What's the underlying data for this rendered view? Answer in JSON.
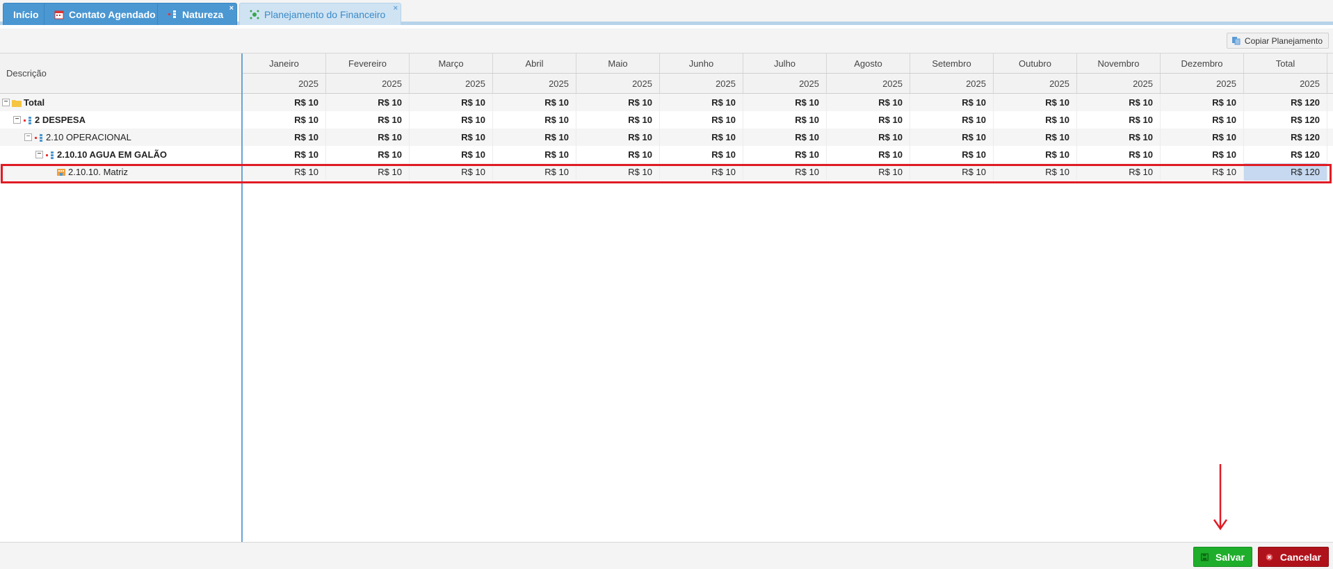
{
  "tabs": [
    {
      "label": "Início"
    },
    {
      "label": "Contato Agendado"
    },
    {
      "label": "Natureza",
      "close": "×"
    },
    {
      "label": "Planejamento do Financeiro",
      "close": "×"
    }
  ],
  "toolbar": {
    "copy_label": "Copiar Planejamento"
  },
  "grid": {
    "desc_header": "Descrição",
    "months": [
      "Janeiro",
      "Fevereiro",
      "Março",
      "Abril",
      "Maio",
      "Junho",
      "Julho",
      "Agosto",
      "Setembro",
      "Outubro",
      "Novembro",
      "Dezembro",
      "Total"
    ],
    "years": [
      "2025",
      "2025",
      "2025",
      "2025",
      "2025",
      "2025",
      "2025",
      "2025",
      "2025",
      "2025",
      "2025",
      "2025",
      "2025"
    ],
    "rows": [
      {
        "label": "Total",
        "toggle": "−",
        "values": [
          "R$ 10",
          "R$ 10",
          "R$ 10",
          "R$ 10",
          "R$ 10",
          "R$ 10",
          "R$ 10",
          "R$ 10",
          "R$ 10",
          "R$ 10",
          "R$ 10",
          "R$ 10",
          "R$ 120"
        ]
      },
      {
        "label": "2 DESPESA",
        "toggle": "−",
        "values": [
          "R$ 10",
          "R$ 10",
          "R$ 10",
          "R$ 10",
          "R$ 10",
          "R$ 10",
          "R$ 10",
          "R$ 10",
          "R$ 10",
          "R$ 10",
          "R$ 10",
          "R$ 10",
          "R$ 120"
        ]
      },
      {
        "label": "2.10 OPERACIONAL",
        "toggle": "−",
        "values": [
          "R$ 10",
          "R$ 10",
          "R$ 10",
          "R$ 10",
          "R$ 10",
          "R$ 10",
          "R$ 10",
          "R$ 10",
          "R$ 10",
          "R$ 10",
          "R$ 10",
          "R$ 10",
          "R$ 120"
        ]
      },
      {
        "label": "2.10.10 AGUA EM GALÃO",
        "toggle": "−",
        "values": [
          "R$ 10",
          "R$ 10",
          "R$ 10",
          "R$ 10",
          "R$ 10",
          "R$ 10",
          "R$ 10",
          "R$ 10",
          "R$ 10",
          "R$ 10",
          "R$ 10",
          "R$ 10",
          "R$ 120"
        ]
      },
      {
        "label": "2.10.10. Matriz",
        "values": [
          "R$ 10",
          "R$ 10",
          "R$ 10",
          "R$ 10",
          "R$ 10",
          "R$ 10",
          "R$ 10",
          "R$ 10",
          "R$ 10",
          "R$ 10",
          "R$ 10",
          "R$ 10",
          "R$ 120"
        ]
      }
    ]
  },
  "footer": {
    "save_label": "Salvar",
    "cancel_label": "Cancelar"
  },
  "colors": {
    "tab_blue": "#4a97d2",
    "save_green": "#1fae2b",
    "cancel_red": "#b0121b",
    "highlight_red": "#e01b24",
    "selected_cell": "#c6d9f0"
  }
}
